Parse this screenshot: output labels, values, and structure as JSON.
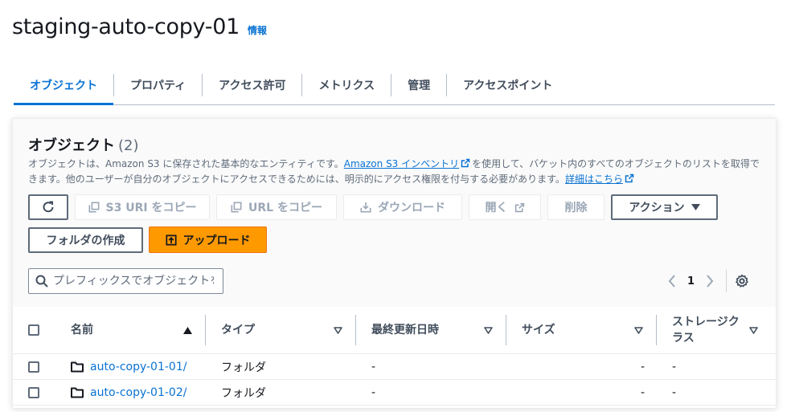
{
  "page": {
    "title": "staging-auto-copy-01",
    "info_label": "情報"
  },
  "tabs": [
    {
      "label": "オブジェクト",
      "active": true
    },
    {
      "label": "プロパティ",
      "active": false
    },
    {
      "label": "アクセス許可",
      "active": false
    },
    {
      "label": "メトリクス",
      "active": false
    },
    {
      "label": "管理",
      "active": false
    },
    {
      "label": "アクセスポイント",
      "active": false
    }
  ],
  "objects": {
    "heading": "オブジェクト",
    "count": "(2)",
    "desc_part1": "オブジェクトは、Amazon S3 に保存された基本的なエンティティです。",
    "inventory_link": "Amazon S3 インベントリ",
    "desc_part2": "を使用して、バケット内のすべてのオブジェクトのリストを取得できます。他のユーザーが自分のオブジェクトにアクセスできるためには、明示的にアクセス権限を付与する必要があります。",
    "details_link": "詳細はこちら"
  },
  "toolbar": {
    "copy_s3_uri": "S3 URI をコピー",
    "copy_url": "URL をコピー",
    "download": "ダウンロード",
    "open": "開く",
    "delete": "削除",
    "actions": "アクション",
    "create_folder": "フォルダの作成",
    "upload": "アップロード"
  },
  "search": {
    "placeholder": "プレフィックスでオブジェクトを検索"
  },
  "pagination": {
    "current_page": "1"
  },
  "table": {
    "columns": {
      "name": "名前",
      "type": "タイプ",
      "last_modified": "最終更新日時",
      "size": "サイズ",
      "storage_class": "ストレージクラス"
    },
    "rows": [
      {
        "name": "auto-copy-01-01/",
        "type": "フォルダ",
        "last_modified": "-",
        "size": "-",
        "storage_class": "-"
      },
      {
        "name": "auto-copy-01-02/",
        "type": "フォルダ",
        "last_modified": "-",
        "size": "-",
        "storage_class": "-"
      }
    ]
  },
  "colors": {
    "accent": "#0972d3",
    "primary_button": "#ff9900",
    "text": "#16191f"
  }
}
